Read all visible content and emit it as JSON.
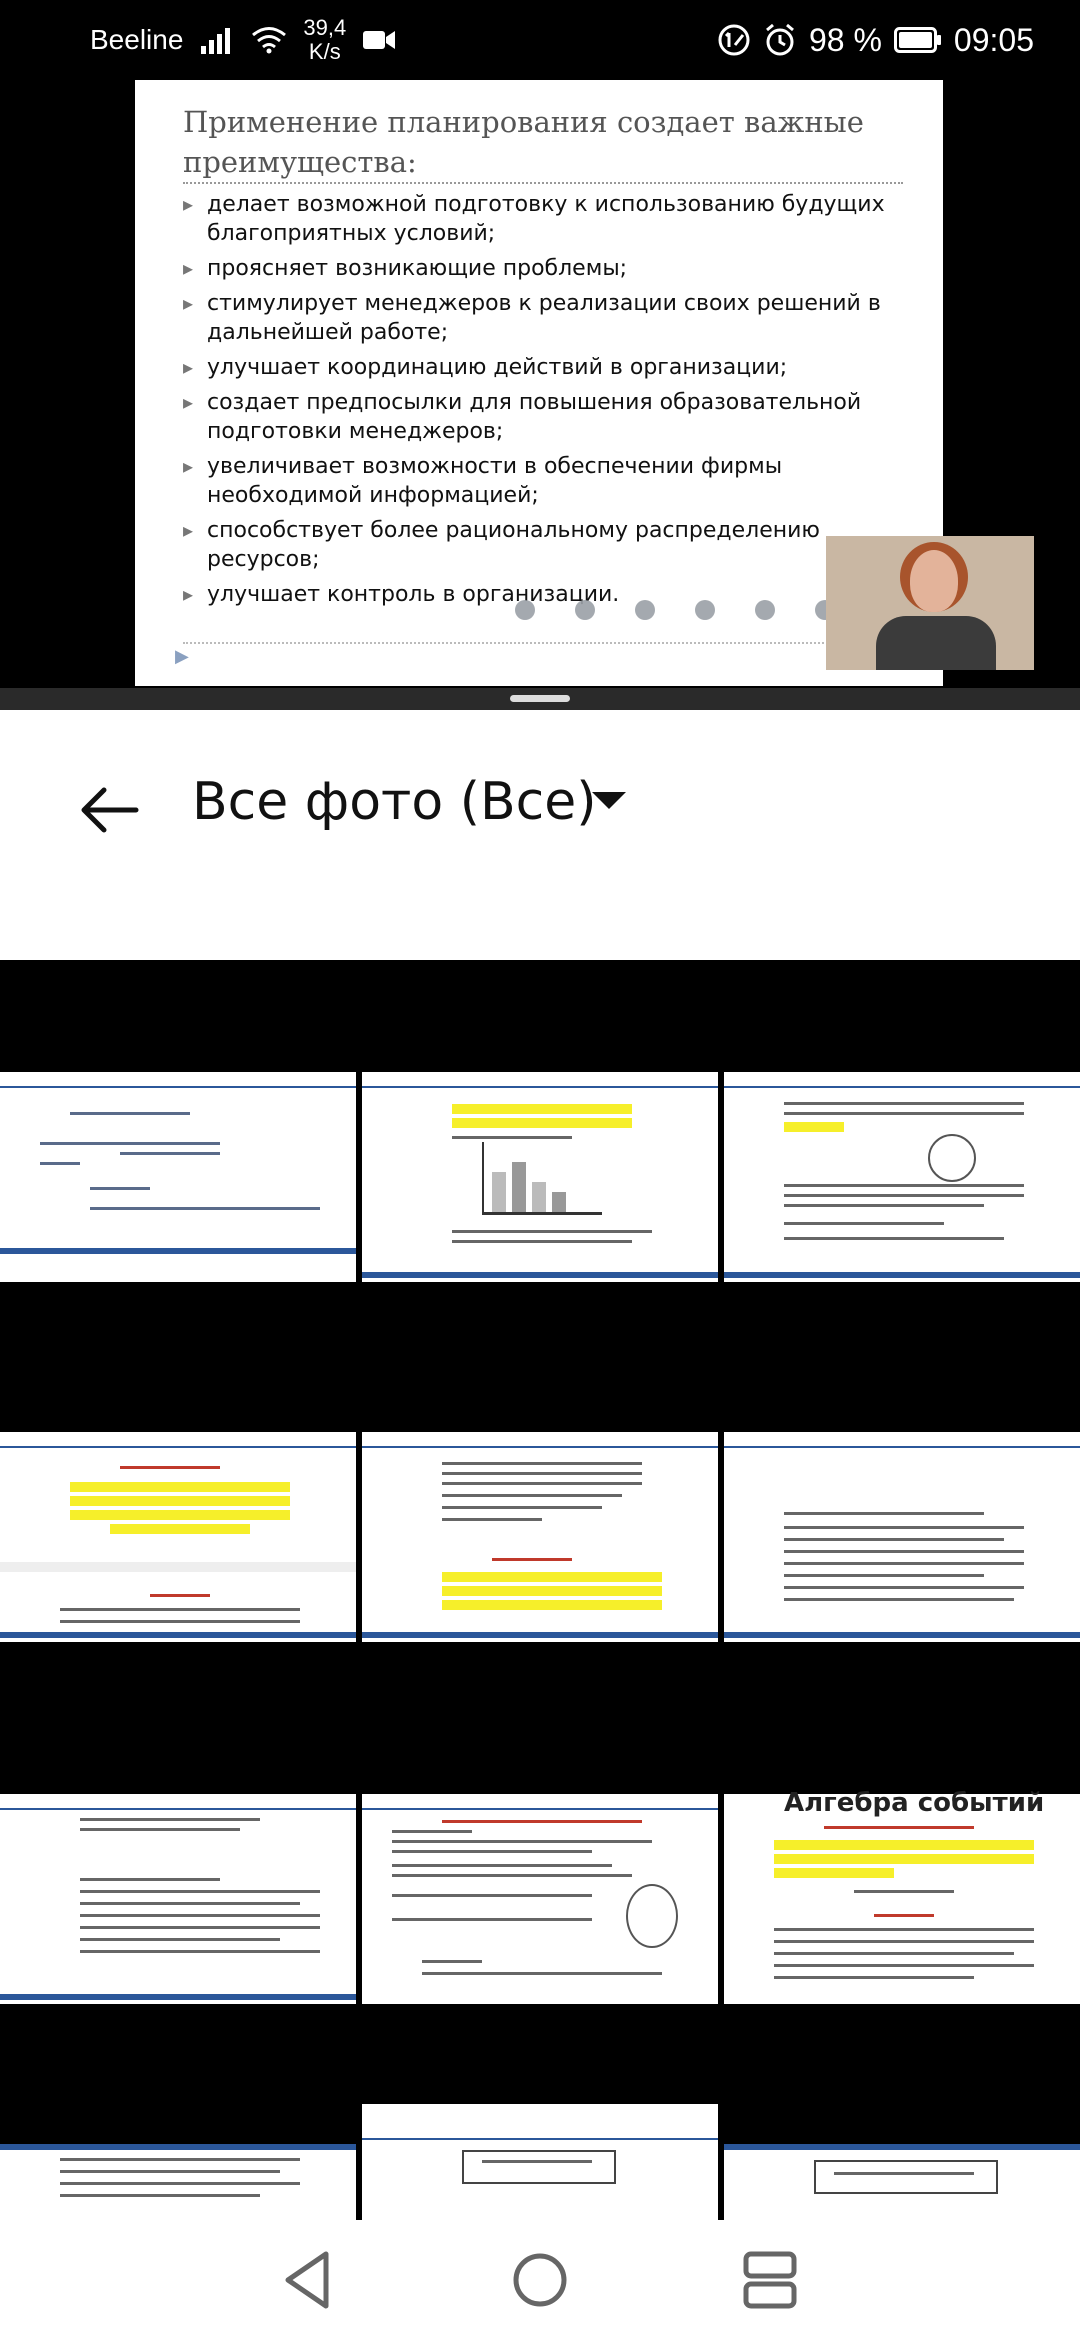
{
  "status_bar": {
    "carrier": "Beeline",
    "speed_value": "39,4",
    "speed_unit": "K/s",
    "battery": "98 %",
    "time": "09:05"
  },
  "video": {
    "slide_title": "Применение планирования создает важные преимущества:",
    "bullets": [
      "делает возможной подготовку к использованию будущих благоприятных условий;",
      "проясняет возникающие проблемы;",
      "стимулирует менеджеров к реализации своих решений в дальнейшей работе;",
      "улучшает координацию действий в организации;",
      "создает предпосылки для повышения образовательной подготовки менеджеров;",
      "увеличивает возможности в обеспечении фирмы необходимой информацией;",
      "способствует более рациональному распределению ресурсов;",
      "улучшает контроль в организации."
    ]
  },
  "header": {
    "title": "Все фото (Все)"
  },
  "grid": {
    "thumbnails": [
      "document-thumbnail-1",
      "document-thumbnail-2",
      "document-thumbnail-3",
      "document-thumbnail-4",
      "document-thumbnail-5",
      "document-thumbnail-6",
      "document-thumbnail-7",
      "document-thumbnail-8",
      "document-thumbnail-9",
      "document-thumbnail-10",
      "document-thumbnail-11",
      "document-thumbnail-12"
    ],
    "thumb_texts": {
      "t9_title": "Алгебра событий"
    }
  },
  "colors": {
    "word_blue": "#2b579a",
    "highlight": "#f6ef2a"
  }
}
